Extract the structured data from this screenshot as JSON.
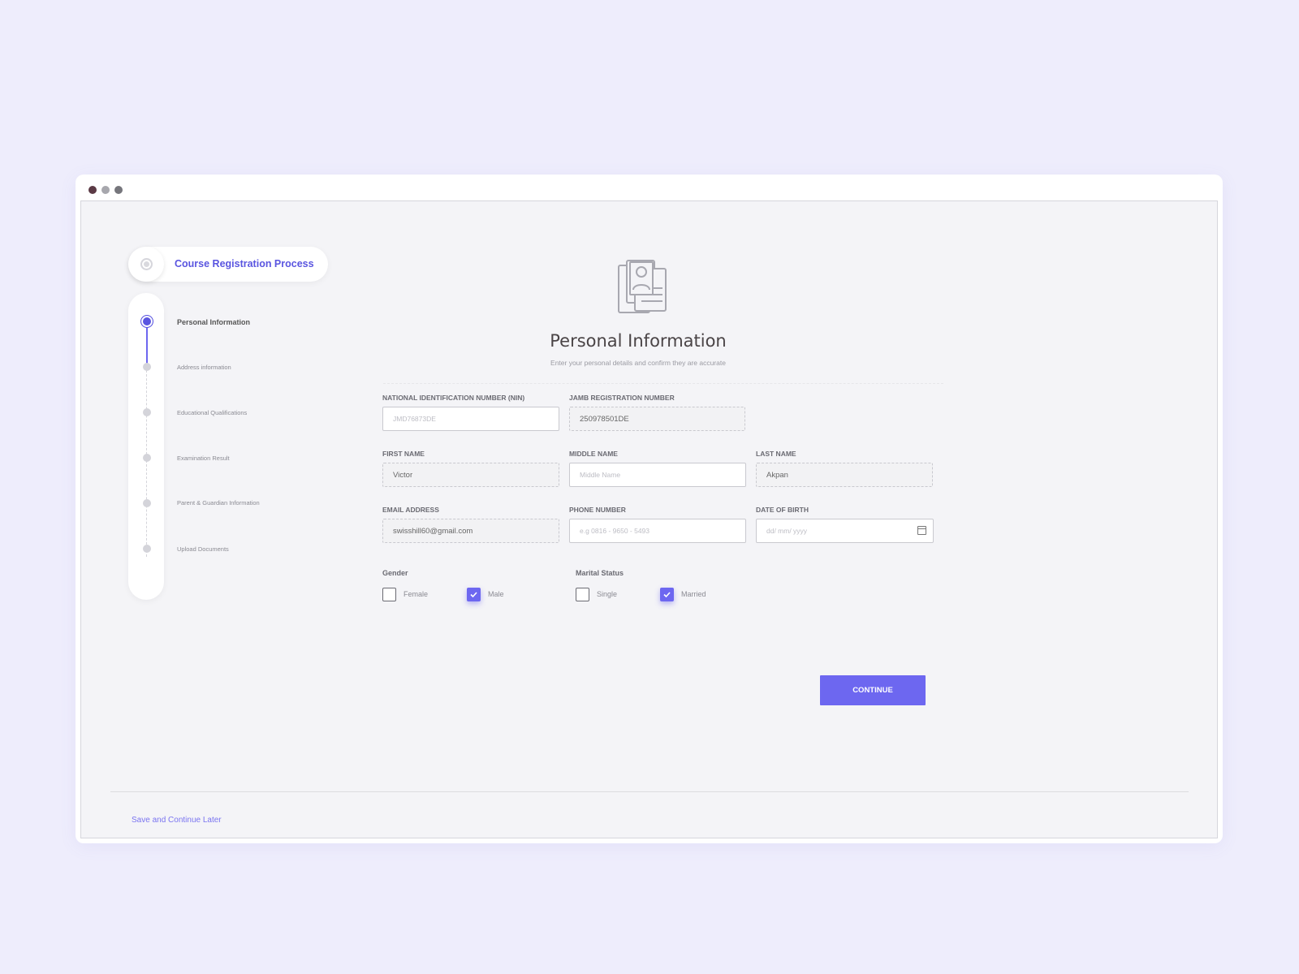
{
  "window": {
    "controls": [
      {
        "name": "close",
        "color": "#5b3a45"
      },
      {
        "name": "minimize",
        "color": "#a7a7ad"
      },
      {
        "name": "maximize",
        "color": "#76767c"
      }
    ]
  },
  "sidebar": {
    "title": "Course Registration Process",
    "steps": [
      {
        "label": "Personal Information",
        "active": true
      },
      {
        "label": "Address information",
        "active": false
      },
      {
        "label": "Educational Qualifications",
        "active": false
      },
      {
        "label": "Examination Result",
        "active": false
      },
      {
        "label": "Parent & Guardian Information",
        "active": false
      },
      {
        "label": "Upload Documents",
        "active": false
      }
    ]
  },
  "form": {
    "icon": "document-user-icon",
    "title": "Personal Information",
    "subtitle": "Enter your personal details and confirm they are accurate",
    "nin": {
      "label": "NATIONAL IDENTIFICATION NUMBER (NIN)",
      "value": "",
      "placeholder": "JMD76873DE"
    },
    "jamb": {
      "label": "JAMB REGISTRATION NUMBER",
      "value": "250978501DE",
      "placeholder": ""
    },
    "first_name": {
      "label": "FIRST NAME",
      "value": "Victor",
      "placeholder": ""
    },
    "middle_name": {
      "label": "MIDDLE NAME",
      "value": "",
      "placeholder": "Middle Name"
    },
    "last_name": {
      "label": "LAST NAME",
      "value": "Akpan",
      "placeholder": ""
    },
    "email": {
      "label": "EMAIL ADDRESS",
      "value": "swisshill60@gmail.com",
      "placeholder": ""
    },
    "phone": {
      "label": "PHONE NUMBER",
      "value": "",
      "placeholder": "e.g 0816 - 9650 - 5493"
    },
    "dob": {
      "label": "DATE OF BIRTH",
      "value": "",
      "placeholder": "dd/ mm/ yyyy",
      "icon": "calendar-icon"
    },
    "gender": {
      "label": "Gender",
      "options": [
        {
          "label": "Female",
          "checked": false
        },
        {
          "label": "Male",
          "checked": true
        }
      ]
    },
    "marital_status": {
      "label": "Marital Status",
      "options": [
        {
          "label": "Single",
          "checked": false
        },
        {
          "label": "Married",
          "checked": true
        }
      ]
    },
    "continue_label": "CONTINUE",
    "accent_color": "#6d67f0"
  },
  "footer": {
    "save_later_label": "Save and Continue Later"
  }
}
